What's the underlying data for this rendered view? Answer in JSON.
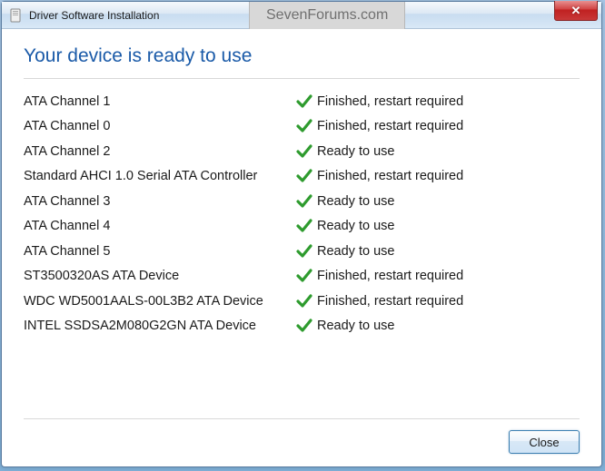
{
  "window": {
    "title": "Driver Software Installation",
    "watermark": "SevenForums.com"
  },
  "content": {
    "heading": "Your device is ready to use"
  },
  "devices": [
    {
      "name": "ATA Channel 1",
      "status": "Finished, restart required"
    },
    {
      "name": "ATA Channel 0",
      "status": "Finished, restart required"
    },
    {
      "name": "ATA Channel 2",
      "status": "Ready to use"
    },
    {
      "name": "Standard AHCI 1.0 Serial ATA Controller",
      "status": "Finished, restart required"
    },
    {
      "name": "ATA Channel 3",
      "status": "Ready to use"
    },
    {
      "name": "ATA Channel 4",
      "status": "Ready to use"
    },
    {
      "name": "ATA Channel 5",
      "status": "Ready to use"
    },
    {
      "name": "ST3500320AS ATA Device",
      "status": "Finished, restart required"
    },
    {
      "name": "WDC WD5001AALS-00L3B2 ATA Device",
      "status": "Finished, restart required"
    },
    {
      "name": "INTEL SSDSA2M080G2GN ATA Device",
      "status": "Ready to use"
    }
  ],
  "footer": {
    "close_label": "Close"
  }
}
